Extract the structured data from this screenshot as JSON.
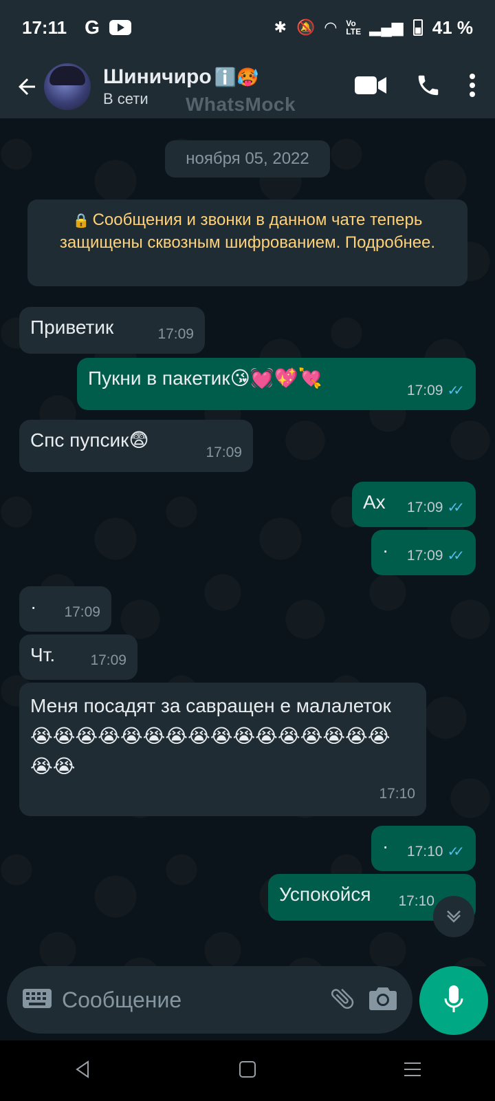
{
  "status_bar": {
    "time": "17:11",
    "google": "G",
    "battery_percent": "41 %",
    "network_label": "Vo LTE"
  },
  "header": {
    "contact_name": "Шиничиро",
    "name_emojis": "ℹ️🥵",
    "status": "В сети",
    "watermark": "WhatsMock"
  },
  "chat": {
    "date": "ноября 05, 2022",
    "encryption_notice": "Сообщения и звонки в данном чате теперь защищены сквозным шифрованием. Подробнее.",
    "messages": [
      {
        "dir": "in",
        "text": "Приветик",
        "time": "17:09"
      },
      {
        "dir": "out",
        "text": "Пукни в пакетик😘💓💖💘",
        "time": "17:09"
      },
      {
        "dir": "in",
        "text": "Спс пупсик😨",
        "time": "17:09"
      },
      {
        "dir": "out",
        "text": "Ах",
        "time": "17:09"
      },
      {
        "dir": "out",
        "text": "·",
        "time": "17:09"
      },
      {
        "dir": "in",
        "text": "·",
        "time": "17:09"
      },
      {
        "dir": "in",
        "text": "Чт.",
        "time": "17:09"
      },
      {
        "dir": "in",
        "text": "Меня посадят за савращен е малалеток😭😭😭😭😭😭😭😭😭😭😭😭😭😭😭😭😭😭",
        "time": "17:10"
      },
      {
        "dir": "out",
        "text": "·",
        "time": "17:10"
      },
      {
        "dir": "out",
        "text": "Успокойся",
        "time": "17:10"
      }
    ]
  },
  "input": {
    "placeholder": "Сообщение"
  },
  "colors": {
    "header_bg": "#1f2c34",
    "chat_bg": "#0b141a",
    "incoming_bubble": "#1f2c34",
    "outgoing_bubble": "#005c4b",
    "accent": "#00a884",
    "read_ticks": "#53bdeb",
    "notice_text": "#ffd279"
  },
  "icons": [
    "back-arrow-icon",
    "video-call-icon",
    "phone-icon",
    "more-vert-icon",
    "lock-icon",
    "keyboard-icon",
    "attach-icon",
    "camera-icon",
    "mic-icon",
    "chevron-down-icon",
    "nav-back-icon",
    "nav-home-icon",
    "nav-recents-icon"
  ]
}
